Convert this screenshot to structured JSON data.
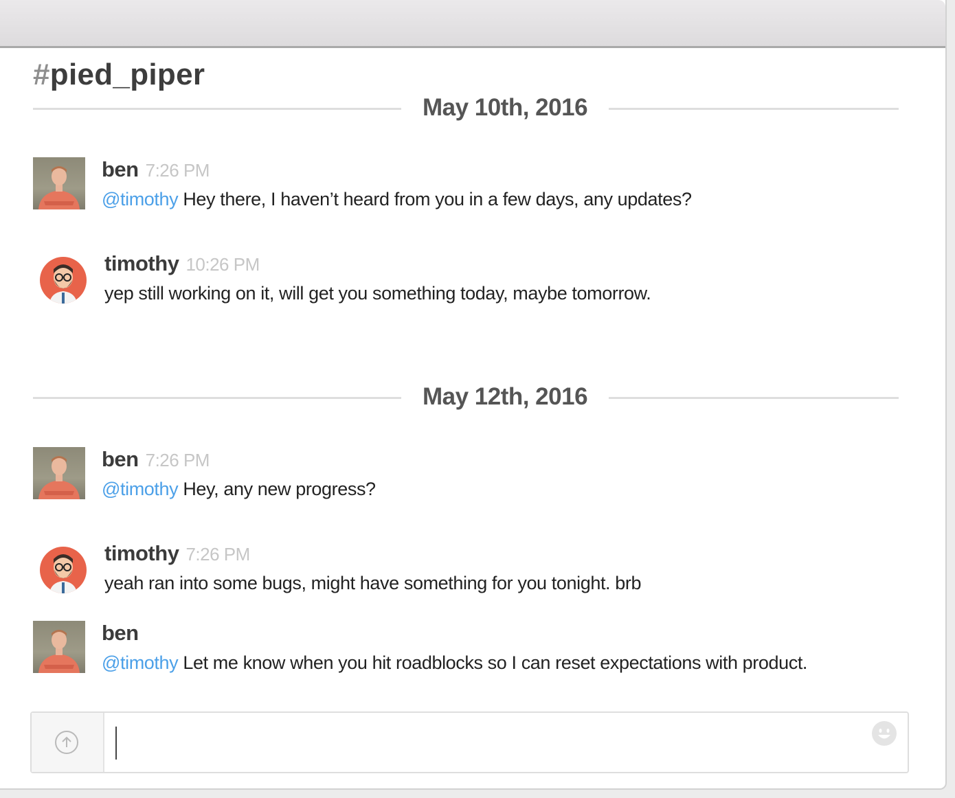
{
  "channel": {
    "hash": "#",
    "name": "pied_piper"
  },
  "days": [
    {
      "date": "May 10th, 2016",
      "messages": [
        {
          "author": "ben",
          "time": "7:26 PM",
          "mention": "@timothy",
          "text": " Hey there, I haven’t heard from you in a few days, any updates?"
        },
        {
          "author": "timothy",
          "time": "10:26 PM",
          "text": "yep still working on it, will get you something today, maybe tomorrow."
        }
      ]
    },
    {
      "date": "May 12th, 2016",
      "messages": [
        {
          "author": "ben",
          "time": "7:26 PM",
          "mention": "@timothy",
          "text": " Hey, any new progress?"
        },
        {
          "author": "timothy",
          "time": "7:26 PM",
          "text": "yeah ran into some bugs, might have something for you tonight. brb"
        },
        {
          "author": "ben",
          "mention": "@timothy",
          "text": " Let me know when you hit roadblocks so I can reset expectations with product."
        }
      ]
    }
  ],
  "composer": {
    "upload_icon": "upload-arrow-icon",
    "emoji_icon": "smiley-icon",
    "value": ""
  },
  "colors": {
    "mention": "#4ca0e8",
    "timothy_avatar": "#e8634a"
  }
}
